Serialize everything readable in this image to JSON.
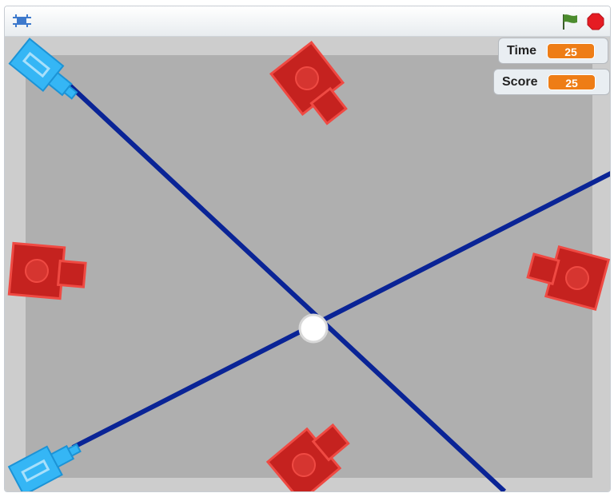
{
  "toolbar": {
    "fullscreen_icon": "fullscreen-icon",
    "flag_icon": "green-flag-icon",
    "stop_icon": "stop-sign-icon"
  },
  "monitors": {
    "time": {
      "label": "Time",
      "value": "25"
    },
    "score": {
      "label": "Score",
      "value": "25"
    }
  },
  "colors": {
    "arena": "#afafaf",
    "wall": "#cdcdcd",
    "laser": "#0a2496",
    "blue_tank": "#35b6f5",
    "red_tank": "#c5221f",
    "monitor_value": "#ee7d16",
    "flag": "#3a7d2a",
    "stop": "#e51c23"
  },
  "sprites": {
    "blue_tanks": 2,
    "red_tanks": 4,
    "center_target": "white-ball"
  }
}
